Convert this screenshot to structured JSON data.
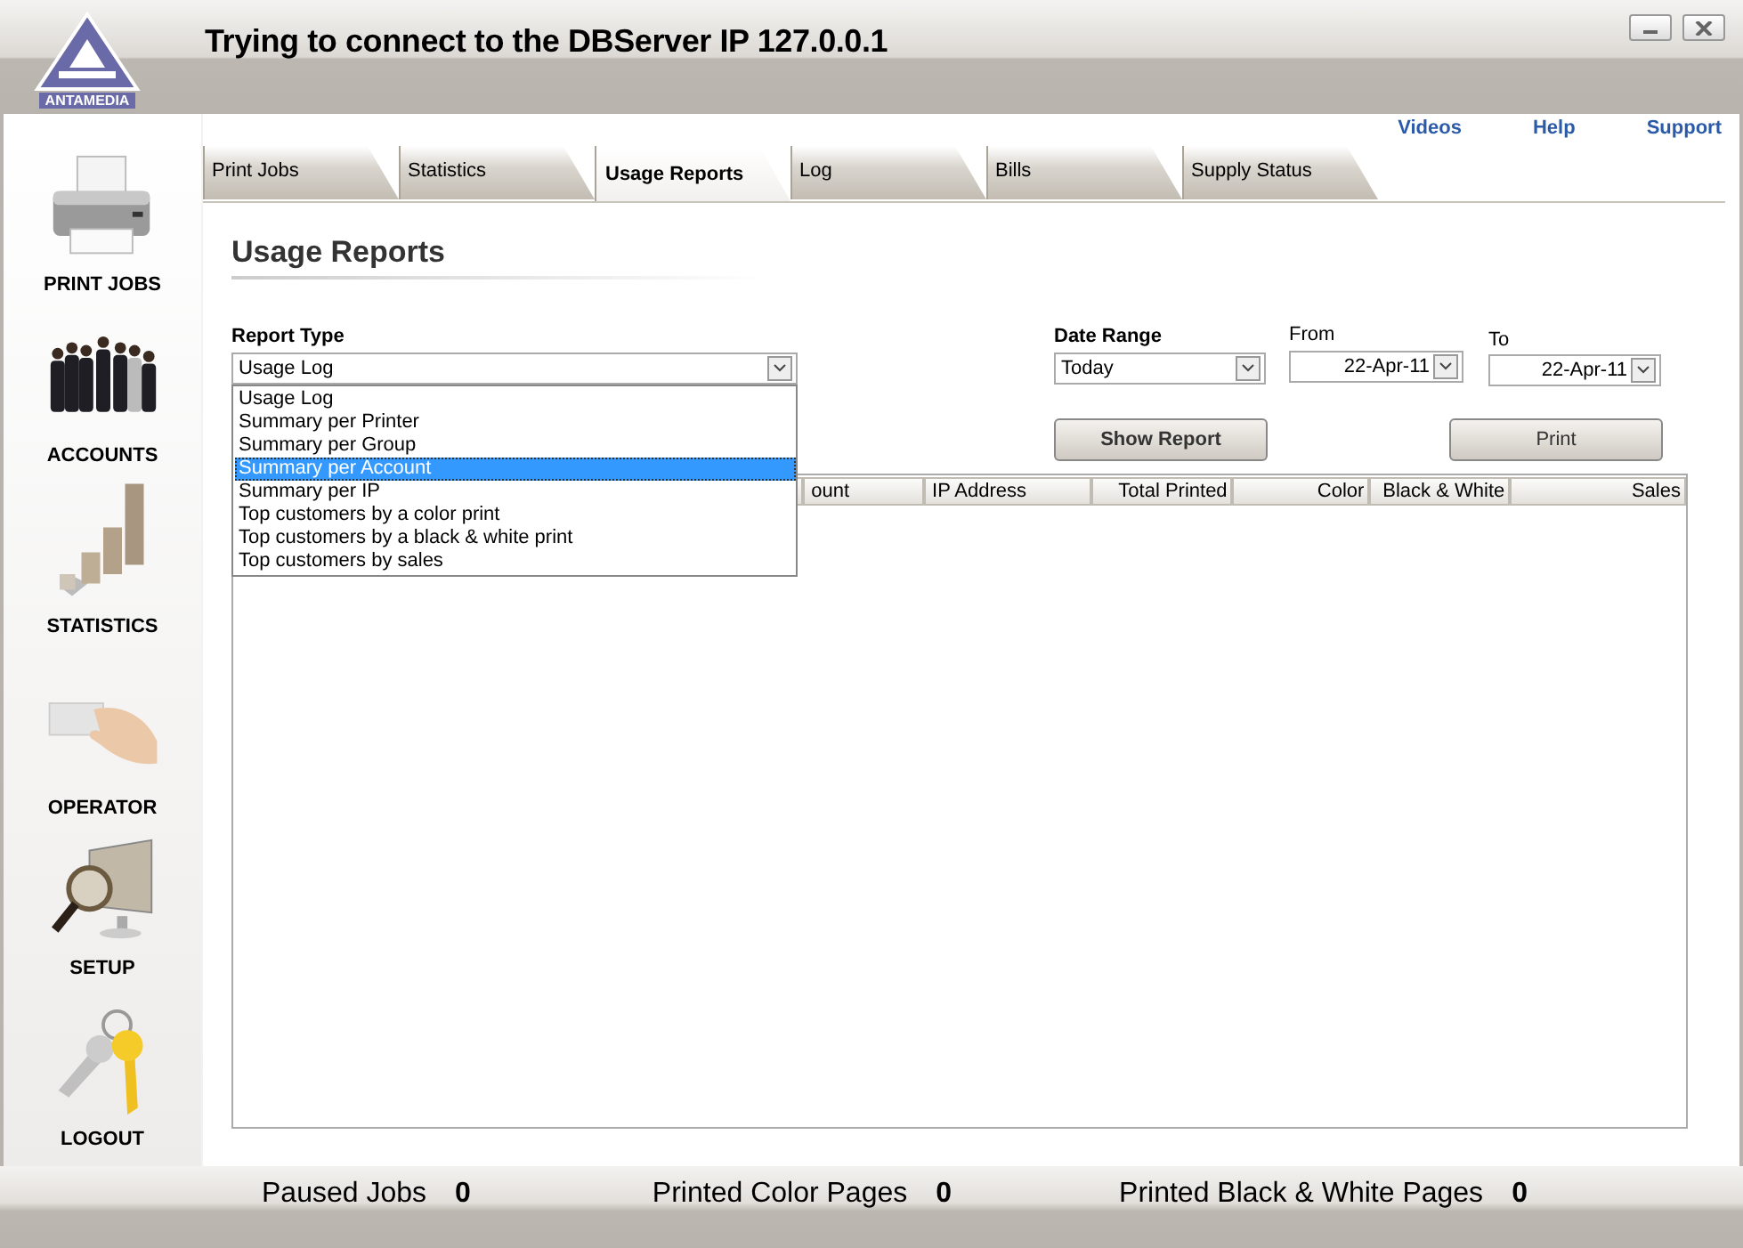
{
  "window": {
    "title": "Trying to connect to the DBServer IP 127.0.0.1",
    "logo_text": "ANTAMEDIA"
  },
  "top_links": [
    "Videos",
    "Help",
    "Support"
  ],
  "sidebar": {
    "items": [
      {
        "kind": "printer",
        "label": "PRINT JOBS"
      },
      {
        "kind": "people",
        "label": "ACCOUNTS"
      },
      {
        "kind": "chart",
        "label": "STATISTICS"
      },
      {
        "kind": "card",
        "label": "OPERATOR"
      },
      {
        "kind": "magnifier",
        "label": "SETUP"
      },
      {
        "kind": "keys",
        "label": "LOGOUT"
      }
    ]
  },
  "tabs": [
    {
      "label": "Print Jobs",
      "selected": false
    },
    {
      "label": "Statistics",
      "selected": false
    },
    {
      "label": "Usage Reports",
      "selected": true
    },
    {
      "label": "Log",
      "selected": false
    },
    {
      "label": "Bills",
      "selected": false
    },
    {
      "label": "Supply Status",
      "selected": false
    }
  ],
  "page_title": "Usage Reports",
  "report_type": {
    "label": "Report Type",
    "value": "Usage Log",
    "expanded": true,
    "options": [
      {
        "label": "Usage Log",
        "highlighted": false
      },
      {
        "label": "Summary per Printer",
        "highlighted": false
      },
      {
        "label": "Summary per Group",
        "highlighted": false
      },
      {
        "label": "Summary per Account",
        "highlighted": true
      },
      {
        "label": "Summary per IP",
        "highlighted": false
      },
      {
        "label": "Top customers by a color print",
        "highlighted": false
      },
      {
        "label": "Top customers by a black & white print",
        "highlighted": false
      },
      {
        "label": "Top customers by sales",
        "highlighted": false
      }
    ]
  },
  "date_range": {
    "label": "Date Range",
    "value": "Today"
  },
  "from": {
    "label": "From",
    "value": "22-Apr-11"
  },
  "to": {
    "label": "To",
    "value": "22-Apr-11"
  },
  "buttons": {
    "show_report": "Show Report",
    "print": "Print"
  },
  "table": {
    "columns": [
      "ount",
      "IP Address",
      "Total Printed",
      "Color",
      "Black & White",
      "Sales"
    ]
  },
  "status_bar": [
    {
      "label": "Paused Jobs",
      "value": "0"
    },
    {
      "label": "Printed Color Pages",
      "value": "0"
    },
    {
      "label": "Printed Black & White Pages",
      "value": "0"
    }
  ]
}
